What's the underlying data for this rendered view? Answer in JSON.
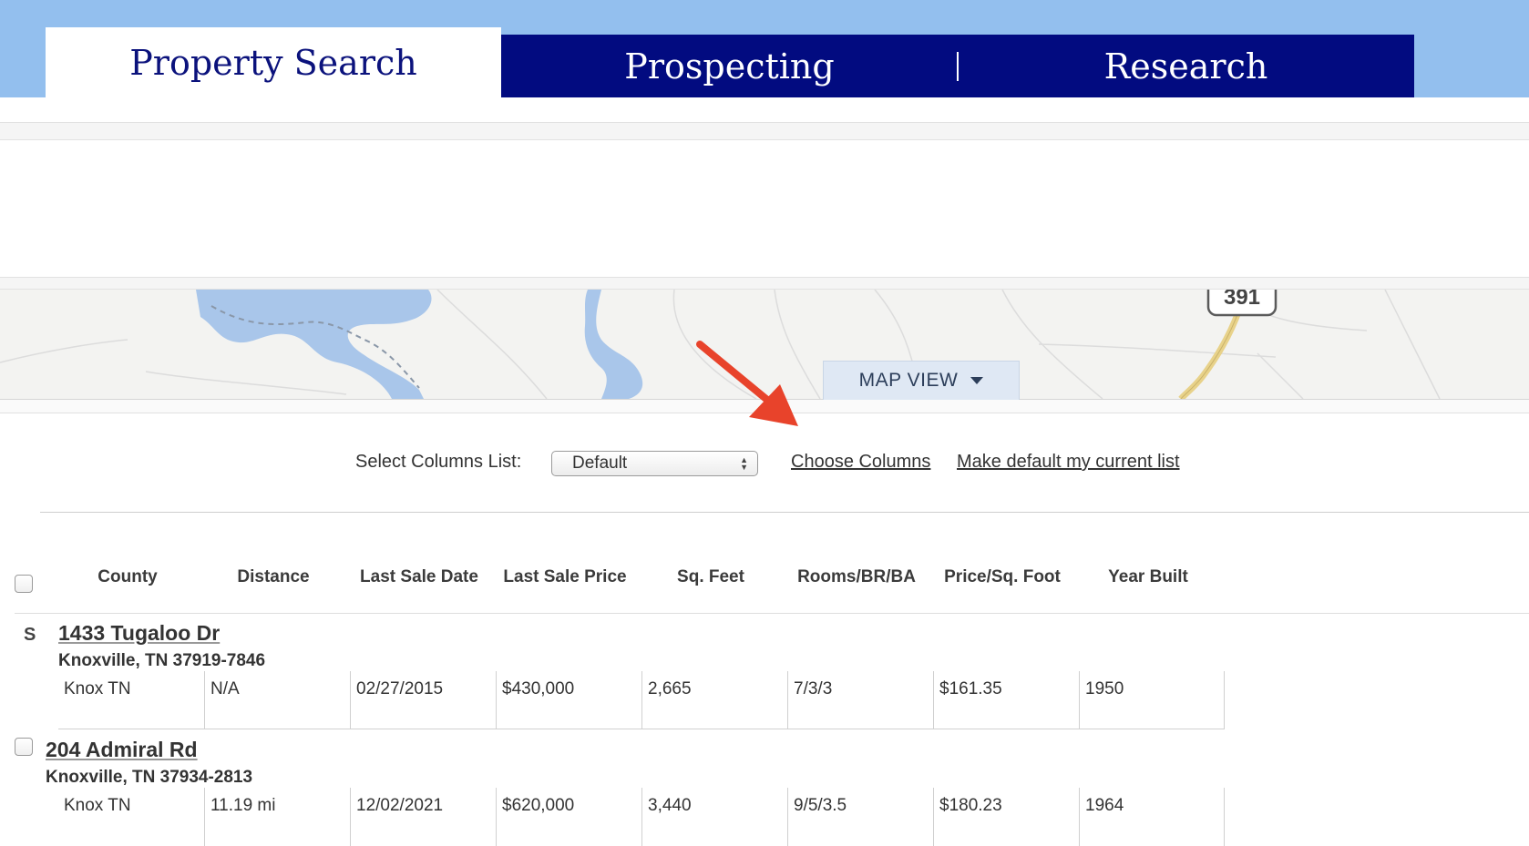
{
  "tabs": [
    {
      "label": "Property Search",
      "active": true
    },
    {
      "label": "Prospecting",
      "active": false
    },
    {
      "label": "Research",
      "active": false
    }
  ],
  "map": {
    "view_button": "MAP VIEW",
    "route_shield": "391",
    "colors": {
      "water": "#a9c6ea",
      "road": "#e8d28a",
      "land": "#f3f3f1"
    }
  },
  "columns_bar": {
    "label": "Select Columns List:",
    "selected": "Default",
    "choose_link": "Choose Columns",
    "default_link": "Make default my current list"
  },
  "table": {
    "headers": [
      "County",
      "Distance",
      "Last Sale Date",
      "Last Sale Price",
      "Sq. Feet",
      "Rooms/BR/BA",
      "Price/Sq. Foot",
      "Year Built"
    ],
    "rows": [
      {
        "marker": "S",
        "address": "1433 Tugaloo Dr",
        "city": "Knoxville, TN 37919-7846",
        "cells": [
          "Knox TN",
          "N/A",
          "02/27/2015",
          "$430,000",
          "2,665",
          "7/3/3",
          "$161.35",
          "1950"
        ]
      },
      {
        "address": "204 Admiral Rd",
        "city": "Knoxville, TN 37934-2813",
        "cells": [
          "Knox TN",
          "11.19 mi",
          "12/02/2021",
          "$620,000",
          "3,440",
          "9/5/3.5",
          "$180.23",
          "1964"
        ]
      }
    ]
  },
  "annotation": {
    "arrow_color": "#e8432b"
  },
  "colors": {
    "top_bar": "#93bfee",
    "tab_dark": "#020b80",
    "tab_active_text": "#0b127c"
  }
}
